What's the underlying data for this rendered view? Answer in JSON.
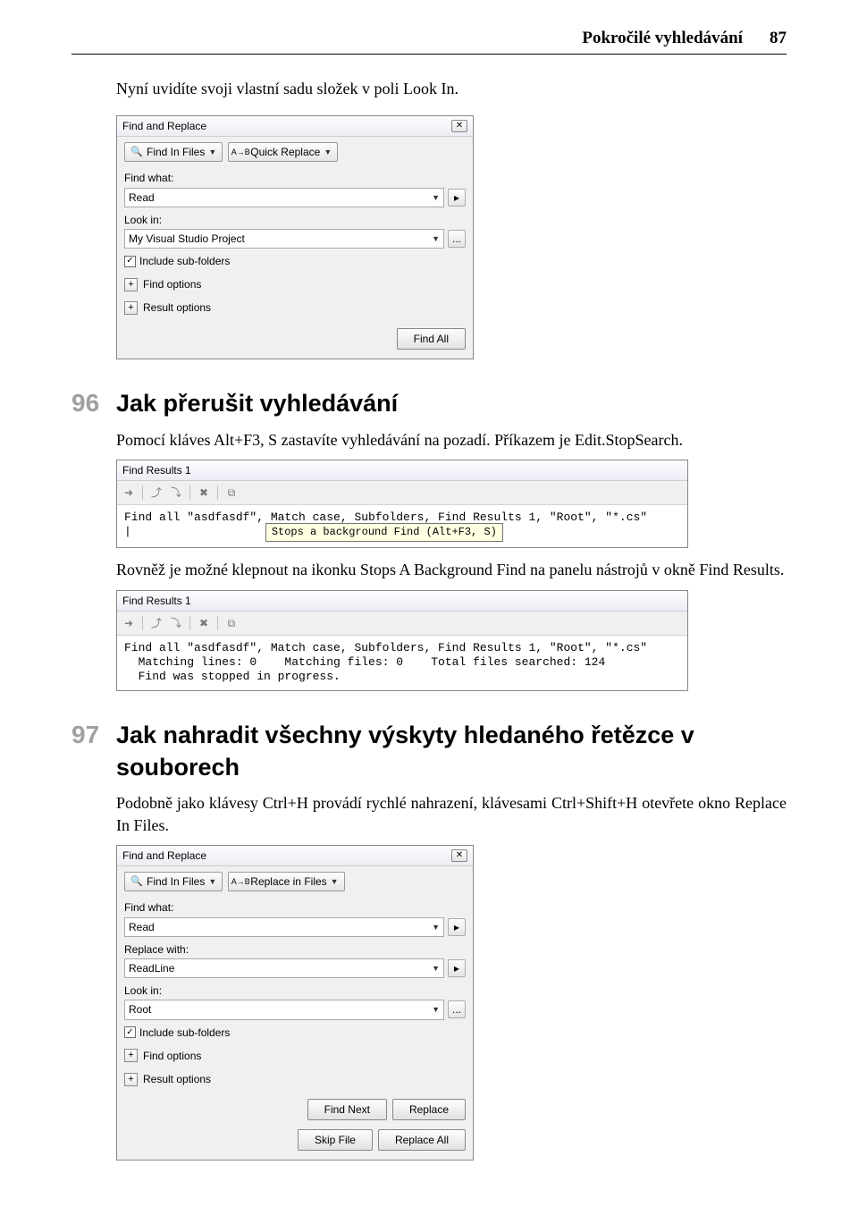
{
  "page": {
    "header_title": "Pokročilé vyhledávání",
    "header_page": "87"
  },
  "intro": "Nyní uvidíte svoji vlastní sadu složek v poli Look In.",
  "sec96": {
    "num": "96",
    "title": "Jak přerušit vyhledávání",
    "p1": "Pomocí kláves Alt+F3, S zastavíte vyhledávání na pozadí. Příkazem je Edit.StopSearch.",
    "p2": "Rovněž je možné klepnout na ikonku Stops A Background Find na panelu nástrojů v okně Find Results."
  },
  "sec97": {
    "num": "97",
    "title": "Jak nahradit všechny výskyty hledaného řetězce v souborech",
    "p1": "Podobně jako klávesy Ctrl+H provádí rychlé nahrazení, klávesami Ctrl+Shift+H otevřete okno Replace In Files."
  },
  "dlg1": {
    "title": "Find and Replace",
    "tab1": "Find In Files",
    "tab2": "Quick Replace",
    "find_what_label": "Find what:",
    "find_what_value": "Read",
    "look_in_label": "Look in:",
    "look_in_value": "My Visual Studio Project",
    "include_sub": "Include sub-folders",
    "find_options": "Find options",
    "result_options": "Result options",
    "find_all": "Find All",
    "browse": "..."
  },
  "panel1": {
    "title": "Find Results 1",
    "line": "Find all \"asdfasdf\", Match case, Subfolders, Find Results 1, \"Root\", \"*.cs\"",
    "cursor": "|",
    "tooltip": "Stops a background Find (Alt+F3, S)"
  },
  "panel2": {
    "title": "Find Results 1",
    "line1": "Find all \"asdfasdf\", Match case, Subfolders, Find Results 1, \"Root\", \"*.cs\"",
    "line2": "  Matching lines: 0    Matching files: 0    Total files searched: 124",
    "line3": "  Find was stopped in progress."
  },
  "dlg3": {
    "title": "Find and Replace",
    "tab1": "Find In Files",
    "tab2": "Replace in Files",
    "find_what_label": "Find what:",
    "find_what_value": "Read",
    "replace_with_label": "Replace with:",
    "replace_with_value": "ReadLine",
    "look_in_label": "Look in:",
    "look_in_value": "Root",
    "include_sub": "Include sub-folders",
    "find_options": "Find options",
    "result_options": "Result options",
    "find_next": "Find Next",
    "replace": "Replace",
    "skip_file": "Skip File",
    "replace_all": "Replace All",
    "browse": "..."
  },
  "icons": {
    "find_in_files": "🔍",
    "quick_replace": "A↔B",
    "play": "▸",
    "checkmark": "✓"
  }
}
